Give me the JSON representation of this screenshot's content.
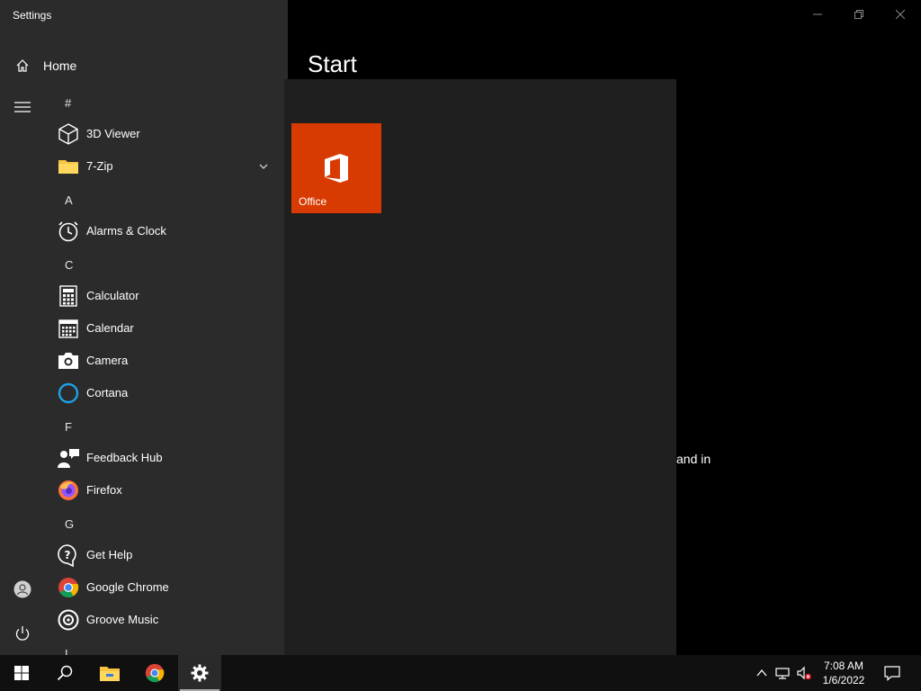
{
  "window": {
    "title": "Settings"
  },
  "sidebar": {
    "home_label": "Home"
  },
  "content": {
    "title": "Start",
    "partial_text": "and in"
  },
  "start_menu": {
    "entries": [
      {
        "kind": "letter",
        "text": "#"
      },
      {
        "kind": "app",
        "label": "3D Viewer",
        "icon": "cube-icon"
      },
      {
        "kind": "app",
        "label": "7-Zip",
        "icon": "folder-icon",
        "expandable": true
      },
      {
        "kind": "letter",
        "text": "A"
      },
      {
        "kind": "app",
        "label": "Alarms & Clock",
        "icon": "alarm-clock-icon"
      },
      {
        "kind": "letter",
        "text": "C"
      },
      {
        "kind": "app",
        "label": "Calculator",
        "icon": "calculator-icon"
      },
      {
        "kind": "app",
        "label": "Calendar",
        "icon": "calendar-icon"
      },
      {
        "kind": "app",
        "label": "Camera",
        "icon": "camera-icon"
      },
      {
        "kind": "app",
        "label": "Cortana",
        "icon": "cortana-icon"
      },
      {
        "kind": "letter",
        "text": "F"
      },
      {
        "kind": "app",
        "label": "Feedback Hub",
        "icon": "feedback-hub-icon"
      },
      {
        "kind": "app",
        "label": "Firefox",
        "icon": "firefox-icon"
      },
      {
        "kind": "letter",
        "text": "G"
      },
      {
        "kind": "app",
        "label": "Get Help",
        "icon": "get-help-icon"
      },
      {
        "kind": "app",
        "label": "Google Chrome",
        "icon": "chrome-icon"
      },
      {
        "kind": "app",
        "label": "Groove Music",
        "icon": "groove-music-icon"
      },
      {
        "kind": "letter",
        "text": "I"
      }
    ],
    "tiles": [
      {
        "label": "Office",
        "icon": "office-icon",
        "color": "#d83b01"
      }
    ]
  },
  "taskbar": {
    "clock_time": "7:08 AM",
    "clock_date": "1/6/2022"
  },
  "colors": {
    "sidebar_bg": "#2b2b2b",
    "menu_bg": "#1f1f1f",
    "taskbar_bg": "#101010",
    "office_tile": "#d83b01",
    "cortana_ring": "#1ea0e6"
  }
}
